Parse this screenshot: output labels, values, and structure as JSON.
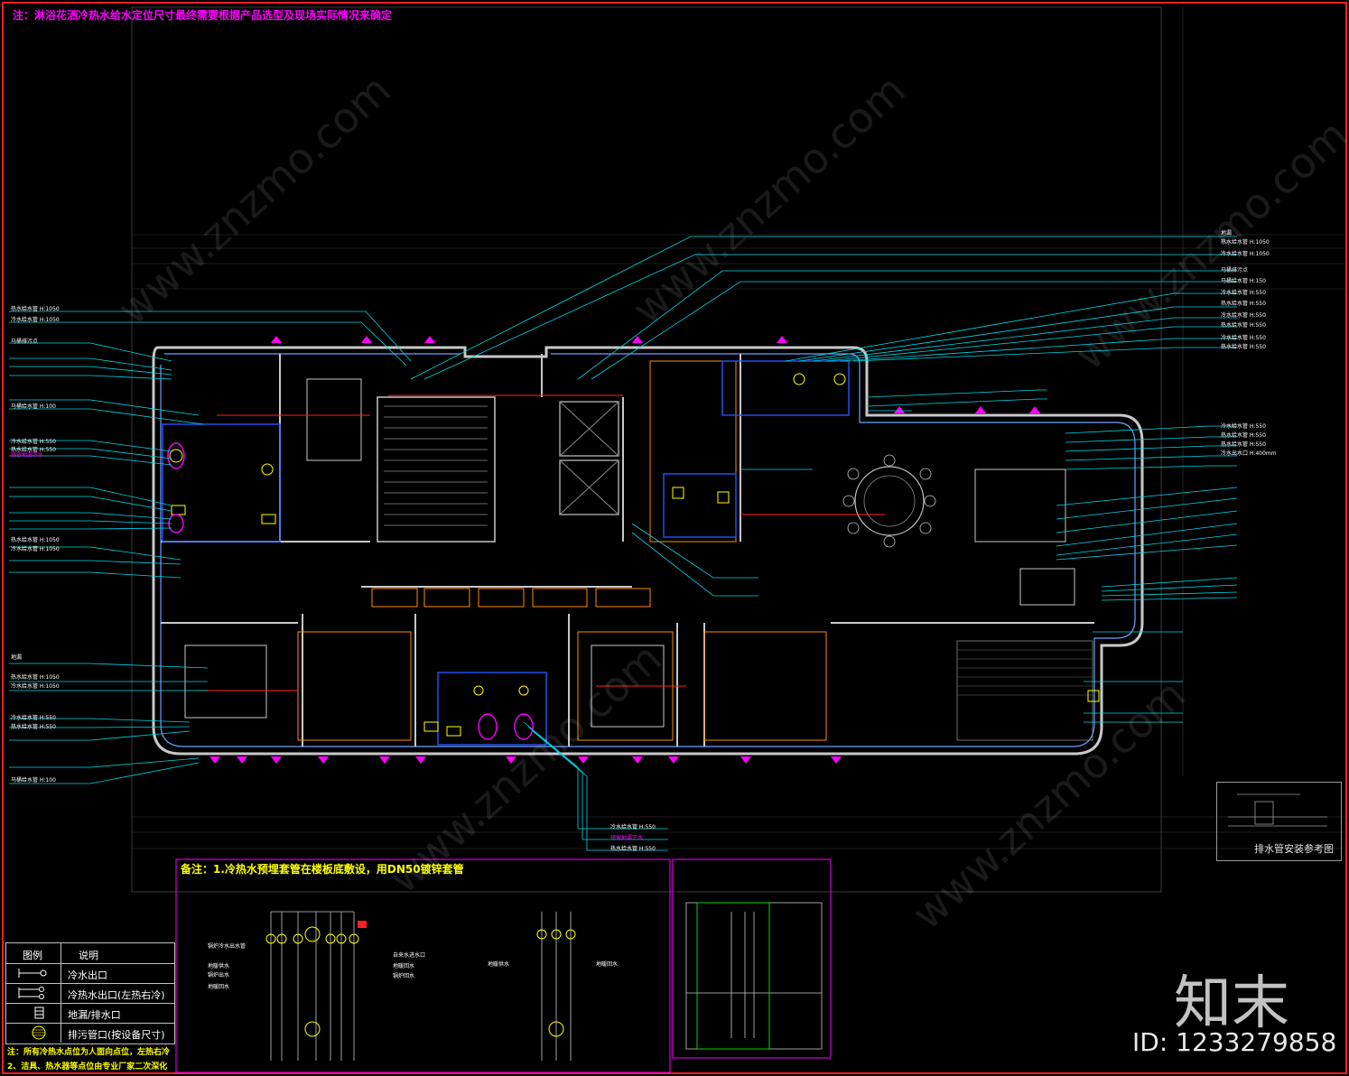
{
  "notes": {
    "title_note": "注：淋浴花洒冷热水给水定位尺寸最终需要根据产品选型及现场实际情况来确定",
    "remark_title": "备注：1.冷热水预埋套管在楼板底敷设，用DN50镀锌套管",
    "bottom_note1": "注：所有冷热水点位为人面向点位，左热右冷",
    "bottom_note2": "2、洁具、热水器等点位由专业厂家二次深化"
  },
  "legend": {
    "header_icon": "图例",
    "header_desc": "说明",
    "items": [
      {
        "icon": "cold-water-outlet-icon",
        "label": "冷水出口"
      },
      {
        "icon": "hot-cold-water-outlet-icon",
        "label": "冷热水出口(左热右冷)"
      },
      {
        "icon": "floor-drain-icon",
        "label": "地漏/排水口"
      },
      {
        "icon": "sewage-outlet-icon",
        "label": "排污管口(按设备尺寸)"
      }
    ]
  },
  "drain_reference": {
    "title": "排水管安装参考图"
  },
  "watermark": {
    "logo": "知末",
    "id": "ID: 1233279858",
    "site": "www.znzmo.com"
  },
  "colors": {
    "magenta": "#ff00ff",
    "yellow": "#ffff00",
    "cyan": "#00d8e8",
    "red_border": "#ff2020",
    "wall": "#c8c8c8",
    "orange": "#ff8c00",
    "blue": "#2255ff"
  },
  "annotations_left": [
    {
      "text": "热水给水管 H:1050",
      "color": "white"
    },
    {
      "text": "冷水给水管 H:1050",
      "color": "white"
    },
    {
      "text": "马桶排污点",
      "color": "white"
    },
    {
      "text": "马桶给水管 H:100",
      "color": "white"
    },
    {
      "text": "冷水给水管 H:550",
      "color": "white"
    },
    {
      "text": "热水给水管 H:550",
      "color": "white"
    },
    {
      "text": "预留地漏下水",
      "color": "magenta"
    },
    {
      "text": "热水给水管 H:1050",
      "color": "white"
    },
    {
      "text": "冷水给水管 H:1050",
      "color": "white"
    },
    {
      "text": "地漏",
      "color": "white"
    },
    {
      "text": "热水给水管 H:1050",
      "color": "white"
    },
    {
      "text": "冷水给水管 H:1050",
      "color": "white"
    },
    {
      "text": "冷水给水管 H:550",
      "color": "white"
    },
    {
      "text": "热水给水管 H:550",
      "color": "white"
    },
    {
      "text": "马桶给水管 H:100",
      "color": "white"
    }
  ],
  "annotations_right": [
    {
      "text": "地漏",
      "color": "white"
    },
    {
      "text": "热水给水管 H:1050",
      "color": "white"
    },
    {
      "text": "冷水给水管 H:1050",
      "color": "white"
    },
    {
      "text": "马桶排污点",
      "color": "white"
    },
    {
      "text": "马桶给水管 H:150",
      "color": "white"
    },
    {
      "text": "冷水给水管 H:550",
      "color": "white"
    },
    {
      "text": "热水给水管 H:550",
      "color": "white"
    },
    {
      "text": "冷水给水管 H:550",
      "color": "white"
    },
    {
      "text": "热水给水管 H:550",
      "color": "white"
    },
    {
      "text": "冷水给水管 H:550",
      "color": "white"
    },
    {
      "text": "热水给水管 H:550",
      "color": "white"
    },
    {
      "text": "冷水给水管 H:550",
      "color": "white"
    },
    {
      "text": "热水给水管 H:550",
      "color": "white"
    },
    {
      "text": "热水给水管 H:550",
      "color": "white"
    },
    {
      "text": "冷水出水口 H:400mm",
      "color": "white"
    }
  ],
  "annotations_bottom": [
    {
      "text": "冷水给水管 H:550",
      "color": "white"
    },
    {
      "text": "预留地漏下水",
      "color": "magenta"
    },
    {
      "text": "热水给水管 H:550",
      "color": "white"
    }
  ]
}
